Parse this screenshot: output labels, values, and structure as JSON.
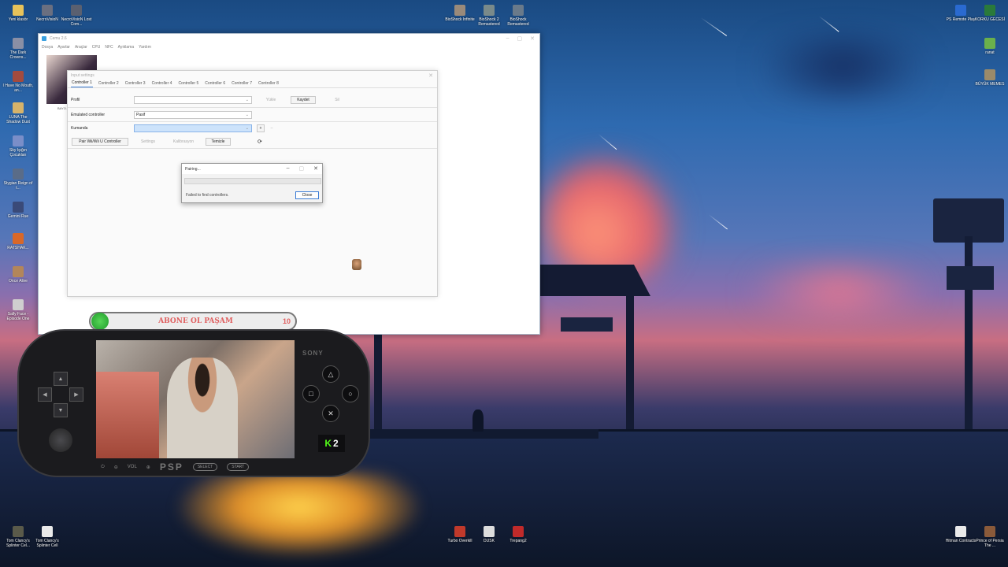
{
  "desktop": {
    "top_left_icons": [
      {
        "label": "Yeni klasör",
        "color": "#e8c35a"
      },
      {
        "label": "NecroVisioN",
        "color": "#6a6f80"
      },
      {
        "label": "NecroVisioN Lost Com...",
        "color": "#5a6070"
      }
    ],
    "left_column_icons": [
      {
        "label": "The Dark Crowns...",
        "color": "#8a8fa5"
      },
      {
        "label": "I Have No Mouth, an...",
        "color": "#a34b3e"
      },
      {
        "label": "LUNA The Shadow Dust",
        "color": "#d6b36a"
      },
      {
        "label": "Sky Işığın Çocukları",
        "color": "#7a8ec8"
      },
      {
        "label": "Stygian Reign of t...",
        "color": "#5a6c88"
      },
      {
        "label": "Gemini Rue",
        "color": "#3a4a78"
      },
      {
        "label": "RATSHAK...",
        "color": "#d8682a"
      },
      {
        "label": "Once Alive",
        "color": "#b3865a"
      },
      {
        "label": "Sally Face - Episode One",
        "color": "#cfcfcf"
      }
    ],
    "top_center_icons": [
      {
        "label": "BioShock Infinite",
        "color": "#9a8a7a"
      },
      {
        "label": "BioShock 2 Remastered",
        "color": "#7a8a8a"
      },
      {
        "label": "BioShock Remastered",
        "color": "#6a7a8a"
      }
    ],
    "top_right_icons": [
      {
        "label": "PS Remote Play",
        "color": "#2a6ad0"
      },
      {
        "label": "KORKU GECESİ",
        "color": "#2a7a3a"
      },
      {
        "label": "ranat",
        "color": "#6ab04c"
      },
      {
        "label": "BÜYÜK MEMES",
        "color": "#9a8a6a"
      }
    ],
    "bottom_left_icons": [
      {
        "label": "Tom Clancy's Splinter Cel...",
        "color": "#5a5a4a"
      },
      {
        "label": "Tom Clancy's Splinter Cell",
        "color": "#eaeaea"
      }
    ],
    "bottom_center_icons": [
      {
        "label": "Turbo Overkill",
        "color": "#c0392b"
      },
      {
        "label": "DUSK",
        "color": "#dcdcdc"
      },
      {
        "label": "Trepang2",
        "color": "#c02a2a"
      }
    ],
    "bottom_right_icons": [
      {
        "label": "Hitman Contracts",
        "color": "#eaeaea"
      },
      {
        "label": "Prince of Persia The ...",
        "color": "#8a5a3a"
      }
    ]
  },
  "cemu": {
    "title": "Cemu 2.6",
    "menu": [
      "Dosya",
      "Ayarlar",
      "Araçlar",
      "CPU",
      "NFC",
      "Ayıklama",
      "Yardım"
    ],
    "game_label": "BAYO..."
  },
  "input_settings": {
    "title": "Input settings",
    "tabs": [
      "Controller 1",
      "Controller 2",
      "Controller 3",
      "Controller 4",
      "Controller 5",
      "Controller 6",
      "Controller 7",
      "Controller 8"
    ],
    "profile_label": "Profil",
    "load_label": "Yükle",
    "save_label": "Kaydet",
    "delete_label": "Sil",
    "emulated_label": "Emulated controller",
    "emulated_value": "Pasif",
    "controller_label": "Kumanda",
    "pair_button": "Pair Wii/Wii U Controller",
    "settings_button": "Settings",
    "calibrate_button": "Kalibrasyon",
    "clear_button": "Temizle"
  },
  "pairing": {
    "title": "Pairing...",
    "message": "Failed to find controllers.",
    "close_label": "Close"
  },
  "overlay": {
    "subscribe_text": "ABONE OL PAŞAM",
    "subscribe_count": "10",
    "sony_label": "SONY",
    "psp_logo": "PSP",
    "vol_label": "VOL",
    "select_label": "SELECT",
    "start_label": "START",
    "kick_number": "2"
  }
}
